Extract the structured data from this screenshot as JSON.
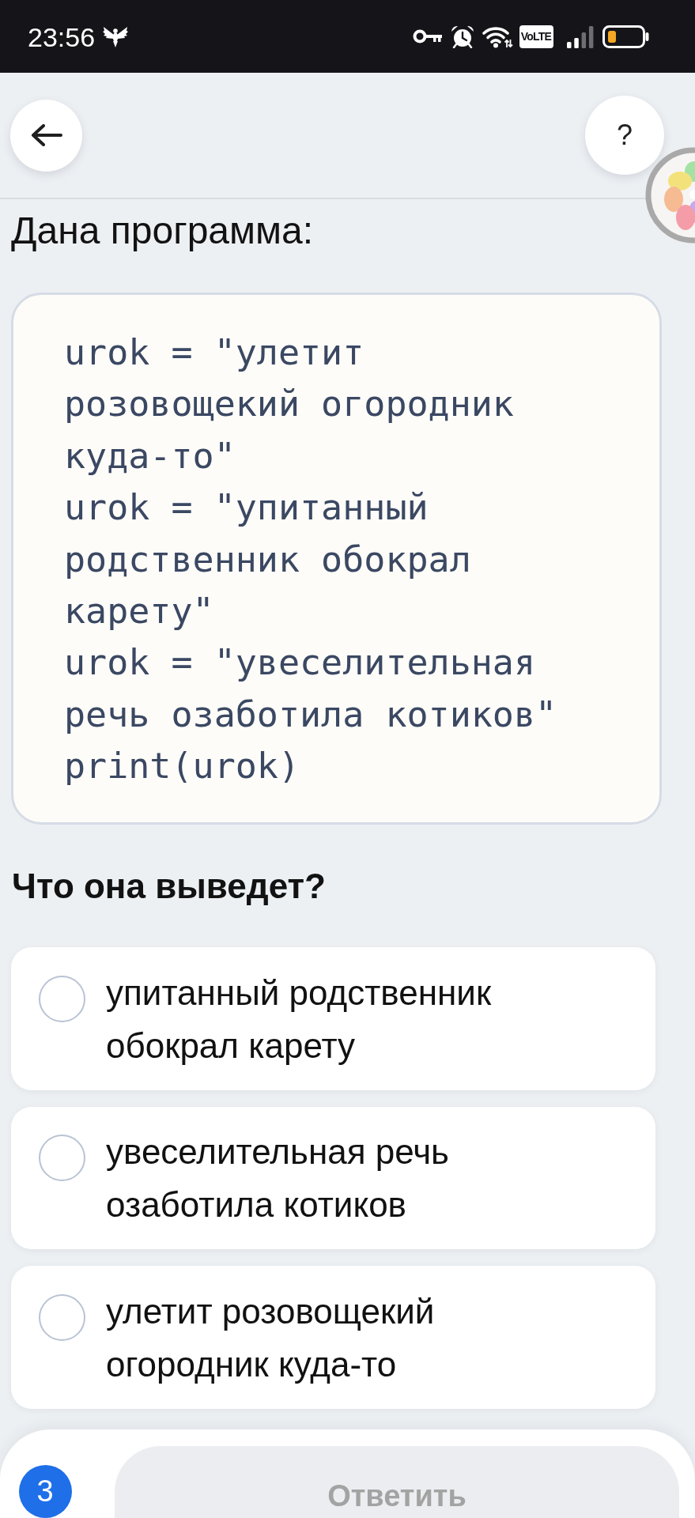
{
  "status_bar": {
    "time": "23:56",
    "network_badge": "VoLTE"
  },
  "top_bar": {
    "help_button": "?"
  },
  "prompt": "Дана программа:",
  "code": {
    "lines": [
      "urok = \"улетит",
      "розовощекий огородник",
      "куда-то\"",
      "urok = \"упитанный",
      "родственник обокрал",
      "карету\"",
      "urok = \"увеселительная",
      "речь озаботила котиков\"",
      "print(urok)"
    ]
  },
  "question": "Что она выведет?",
  "options": [
    {
      "text": "упитанный родственник обокрал карету",
      "selected": false
    },
    {
      "text": "увеселительная речь озаботила котиков",
      "selected": false
    },
    {
      "text": "улетит розовощекий огородник куда-то",
      "selected": false
    }
  ],
  "footer": {
    "question_number": "3",
    "submit_button": {
      "label": "Ответить",
      "disabled": true
    }
  }
}
